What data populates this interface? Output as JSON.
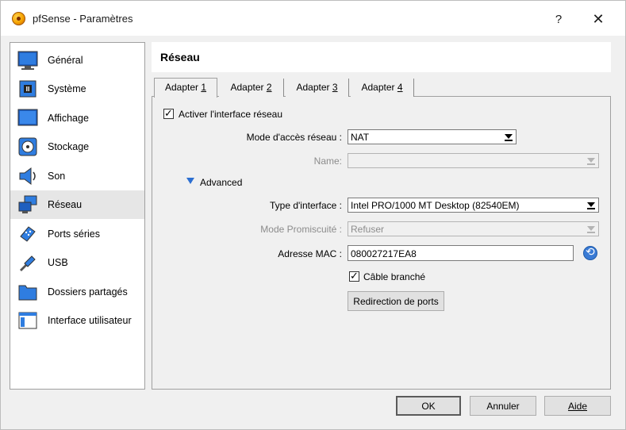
{
  "window": {
    "title": "pfSense - Paramètres",
    "help_label": "?",
    "close_label": "✕"
  },
  "sidebar": {
    "items": [
      {
        "label": "Général",
        "icon": "monitor-icon"
      },
      {
        "label": "Système",
        "icon": "chip-icon"
      },
      {
        "label": "Affichage",
        "icon": "display-icon"
      },
      {
        "label": "Stockage",
        "icon": "disk-icon"
      },
      {
        "label": "Son",
        "icon": "speaker-icon"
      },
      {
        "label": "Réseau",
        "icon": "network-icon",
        "active": true
      },
      {
        "label": "Ports séries",
        "icon": "serial-port-icon"
      },
      {
        "label": "USB",
        "icon": "usb-icon"
      },
      {
        "label": "Dossiers partagés",
        "icon": "folder-icon"
      },
      {
        "label": "Interface utilisateur",
        "icon": "window-icon"
      }
    ]
  },
  "header": {
    "title": "Réseau"
  },
  "tabs": [
    {
      "prefix": "Adapter ",
      "num": "1",
      "active": true
    },
    {
      "prefix": "Adapter ",
      "num": "2"
    },
    {
      "prefix": "Adapter ",
      "num": "3"
    },
    {
      "prefix": "Adapter ",
      "num": "4"
    }
  ],
  "form": {
    "enable_label": "Activer l'interface réseau",
    "enable_checked": true,
    "mode_label": "Mode d'accès réseau :",
    "mode_value": "NAT",
    "name_label": "Name:",
    "name_value": "",
    "advanced_label": "Advanced",
    "type_label": "Type d'interface :",
    "type_value": "Intel PRO/1000 MT Desktop (82540EM)",
    "promisc_label": "Mode Promiscuité :",
    "promisc_value": "Refuser",
    "mac_label": "Adresse MAC :",
    "mac_value": "080027217EA8",
    "cable_label": "Câble branché",
    "cable_checked": true,
    "port_forward_label": "Redirection de ports"
  },
  "buttons": {
    "ok": "OK",
    "cancel": "Annuler",
    "help": "Aide"
  },
  "colors": {
    "accent": "#2c6fd1",
    "panel_bg": "#f0f0f0",
    "active_item": "#e6e6e6"
  }
}
